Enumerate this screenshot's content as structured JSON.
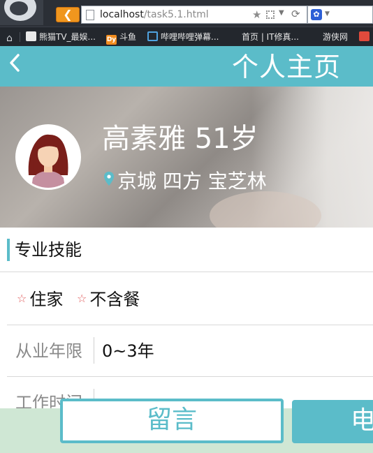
{
  "browser": {
    "url_host": "localhost",
    "url_path": "/task5.1.html",
    "bookmarks": [
      {
        "label": "熊猫TV_最娱...",
        "icon": "panda-icon"
      },
      {
        "label": "斗鱼",
        "icon": "douyu-icon"
      },
      {
        "label": "哔哩哔哩弹幕...",
        "icon": "bilibili-icon"
      },
      {
        "label": "首页 | IT修真...",
        "icon": ""
      },
      {
        "label": "游侠网",
        "icon": ""
      }
    ]
  },
  "header": {
    "back_icon": "chevron-left-icon",
    "title": "个人主页"
  },
  "profile": {
    "name_age": "高素雅 51岁",
    "location": "京城 四方 宝芝林",
    "location_icon": "map-pin-icon"
  },
  "section": {
    "title": "专业技能"
  },
  "tags": [
    "住家",
    "不含餐"
  ],
  "info_rows": [
    {
      "label": "从业年限",
      "value": "0~3年"
    },
    {
      "label": "工作时间",
      "value": ""
    }
  ],
  "actions": {
    "message_label": "留言",
    "call_label": "电"
  },
  "colors": {
    "accent": "#5bbcc9",
    "tag_star": "#e05a5a",
    "bottom_bar": "#cfe7d4"
  }
}
